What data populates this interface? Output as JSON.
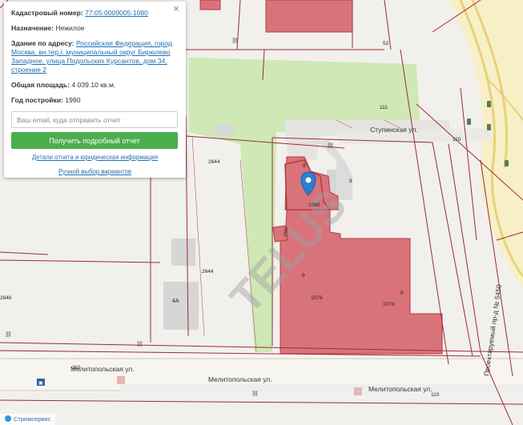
{
  "card": {
    "close_icon": "×",
    "cadastral_label": "Кадастровый номер:",
    "cadastral_value": "77:05:0009005:1080",
    "purpose_label": "Назначение:",
    "purpose_value": "Нежилое",
    "address_label": "Здание по адресу:",
    "address_value": "Российская Федерация, город Москва, вн.тер.г. муниципальный округ Бирюлево Западное, улица Подольских Курсантов, дом 34, строение 2",
    "area_label": "Общая площадь:",
    "area_value": "4 039.10 кв.м.",
    "year_label": "Год постройки:",
    "year_value": "1990",
    "email_placeholder": "Ваш email, куда отправить отчет",
    "report_button": "Получить подробный отчет",
    "details_link": "Детали отчета и юридическая информация",
    "manual_link": "Ручной выбор вариантов"
  },
  "map": {
    "streets": {
      "stupinskaya": "Ступинская ул.",
      "melitopolskaya_1": "Мелитопольская ул.",
      "melitopolskaya_2": "Мелитопольская ул.",
      "melitopolskaya_3": "Мелитопольская ул.",
      "proektiruemy": "Проектируемый пр-д № 5450"
    },
    "parcels": [
      "52",
      "111",
      "110",
      "2644",
      "2644",
      "2646",
      "110",
      "110"
    ],
    "buildings": [
      "1080",
      "1079",
      "1079",
      "9",
      "9",
      "9",
      "9",
      "4А",
      "1080"
    ],
    "watermark": "TELUS",
    "brand": "Стромсервис",
    "metro_icon": "bus-stop-icon"
  },
  "colors": {
    "building_fill": "#d9737a",
    "building_stroke": "#b33a44",
    "parcel_line": "#9e2a3a",
    "green": "#c8e6b0",
    "road_yellow": "#f5eab8",
    "button": "#4cae4c",
    "link": "#1f6fb2",
    "marker": "#2a7fd4"
  }
}
